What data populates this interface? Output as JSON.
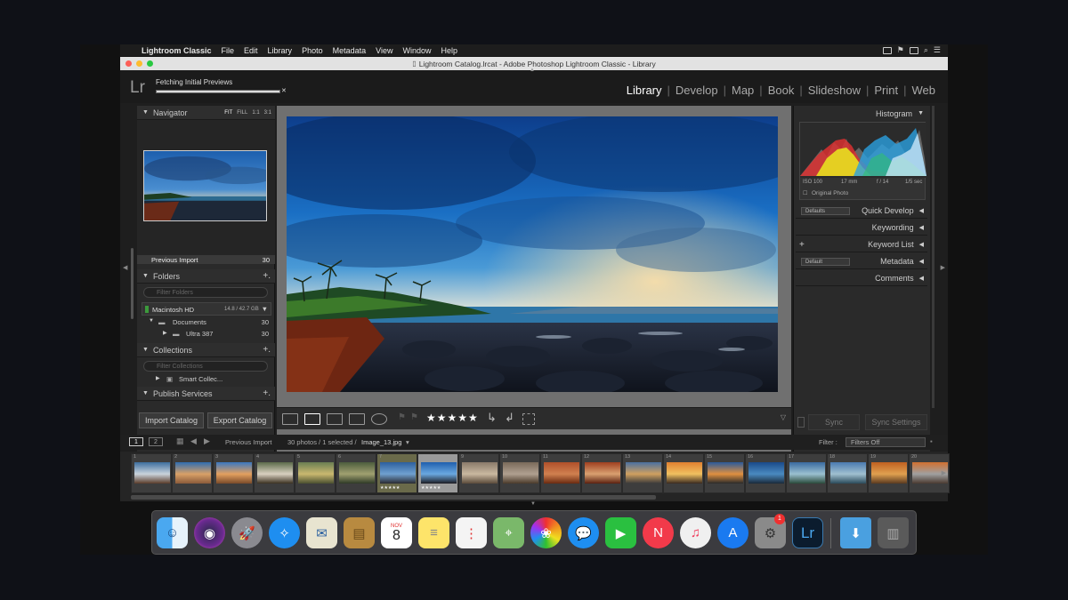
{
  "menubar": {
    "app_name": "Lightroom Classic",
    "items": [
      "File",
      "Edit",
      "Library",
      "Photo",
      "Metadata",
      "View",
      "Window",
      "Help"
    ]
  },
  "window": {
    "title": "Lightroom Catalog.lrcat - Adobe Photoshop Lightroom Classic - Library"
  },
  "topbar": {
    "logo": "Lr",
    "progress_label": "Fetching Initial Previews",
    "modules": [
      "Library",
      "Develop",
      "Map",
      "Book",
      "Slideshow",
      "Print",
      "Web"
    ],
    "active_module": "Library"
  },
  "left_panel": {
    "navigator": {
      "title": "Navigator",
      "zoom": [
        "FIT",
        "FILL",
        "1:1",
        "3:1"
      ]
    },
    "catalog_row": {
      "label": "Previous Import",
      "count": "30"
    },
    "folders": {
      "title": "Folders",
      "filter_placeholder": "Filter Folders",
      "volume": "Macintosh HD",
      "volume_size": "14.8 / 42.7 GB",
      "items": [
        {
          "label": "Documents",
          "count": "30"
        },
        {
          "label": "Ultra 387",
          "count": "30"
        }
      ]
    },
    "collections": {
      "title": "Collections",
      "filter_placeholder": "Filter Collections",
      "items": [
        "Smart Collec..."
      ]
    },
    "publish_services": {
      "title": "Publish Services"
    },
    "buttons": {
      "import": "Import Catalog",
      "export": "Export Catalog"
    }
  },
  "toolbar": {
    "rating": "★★★★★"
  },
  "right_panel": {
    "histogram": {
      "title": "Histogram",
      "iso": "ISO 100",
      "focal": "17 mm",
      "aperture": "f / 14",
      "shutter": "1/5 sec",
      "original_photo": "Original Photo"
    },
    "quick_develop": {
      "title": "Quick Develop",
      "preset": "Defaults"
    },
    "keywording": {
      "title": "Keywording"
    },
    "keyword_list": {
      "title": "Keyword List"
    },
    "metadata": {
      "title": "Metadata",
      "preset": "Default"
    },
    "comments": {
      "title": "Comments"
    },
    "buttons": {
      "sync": "Sync",
      "sync_settings": "Sync Settings"
    }
  },
  "filmstrip_bar": {
    "page1": "1",
    "page2": "2",
    "source": "Previous Import",
    "count_text": "30 photos / 1 selected /",
    "filename": "Image_13.jpg",
    "filter_label": "Filter :",
    "filter_value": "Filters Off"
  },
  "filmstrip": {
    "thumbs": [
      {
        "num": "1",
        "colors": [
          "#3d6e9e",
          "#c9d3dc",
          "#5a3c2a"
        ]
      },
      {
        "num": "2",
        "colors": [
          "#2f6db0",
          "#d8a067",
          "#8a5a3a"
        ]
      },
      {
        "num": "3",
        "colors": [
          "#3a78c0",
          "#e3a060",
          "#7a4a2a"
        ]
      },
      {
        "num": "4",
        "colors": [
          "#5c6b4a",
          "#d9d0c0",
          "#3a3020"
        ]
      },
      {
        "num": "5",
        "colors": [
          "#6a7e52",
          "#c9b870",
          "#4a5030"
        ]
      },
      {
        "num": "6",
        "colors": [
          "#4d5d3d",
          "#a0a070",
          "#2e3a26"
        ]
      },
      {
        "num": "7",
        "colors": [
          "#2c5f9e",
          "#6fa0d0",
          "#2a2a30"
        ],
        "stars": "★★★★★"
      },
      {
        "num": "8",
        "colors": [
          "#1f5fae",
          "#6aa8e0",
          "#1c1c22"
        ],
        "stars": "★★★★★",
        "selected": true
      },
      {
        "num": "9",
        "colors": [
          "#8a7a6a",
          "#c9b8a0",
          "#5a4a3a"
        ]
      },
      {
        "num": "10",
        "colors": [
          "#7a6a5a",
          "#b0a090",
          "#4a3a2a"
        ]
      },
      {
        "num": "11",
        "colors": [
          "#b0502a",
          "#d08050",
          "#6a2a10"
        ]
      },
      {
        "num": "12",
        "colors": [
          "#a04020",
          "#d9a070",
          "#5a2010"
        ]
      },
      {
        "num": "13",
        "colors": [
          "#4a70a0",
          "#d0a060",
          "#3a3a3a"
        ]
      },
      {
        "num": "14",
        "colors": [
          "#e08030",
          "#f0c060",
          "#3a2a20"
        ]
      },
      {
        "num": "15",
        "colors": [
          "#2a5a9a",
          "#e09040",
          "#2a2a2a"
        ]
      },
      {
        "num": "16",
        "colors": [
          "#1a4a8a",
          "#4a8ac0",
          "#1a2a3a"
        ]
      },
      {
        "num": "17",
        "colors": [
          "#3a6aa0",
          "#9ac0d0",
          "#2a4a3a"
        ]
      },
      {
        "num": "18",
        "colors": [
          "#4a7ab0",
          "#a0c0d0",
          "#2a4a5a"
        ]
      },
      {
        "num": "19",
        "colors": [
          "#c06020",
          "#e0a050",
          "#5a3a20"
        ]
      },
      {
        "num": "20",
        "colors": [
          "#d07030",
          "#a0a0a0",
          "#4a3a30"
        ]
      }
    ]
  },
  "dock": {
    "calendar_month": "NOV",
    "calendar_day": "8",
    "badge": "1",
    "lr_label": "Lr",
    "icons": [
      "finder-icon",
      "siri-icon",
      "launchpad-icon",
      "safari-icon",
      "mail-icon",
      "contacts-icon",
      "calendar-icon",
      "notes-icon",
      "reminders-icon",
      "maps-icon",
      "photos-icon",
      "messages-icon",
      "facetime-icon",
      "news-icon",
      "music-icon",
      "app-store-icon",
      "system-preferences-icon",
      "lightroom-icon",
      "downloads-folder-icon",
      "trash-icon"
    ]
  },
  "colors": {
    "lr_bg": "#1e1e1e",
    "panel": "#2a2a2a",
    "center_gray": "#707070",
    "sky_blue": "#1a6fc4",
    "active_text": "#ffffff"
  }
}
